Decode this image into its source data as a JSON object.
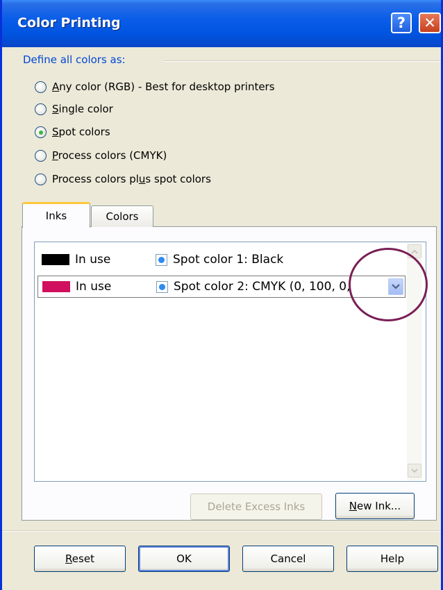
{
  "window": {
    "title": "Color Printing"
  },
  "define": {
    "label": "Define all colors as:",
    "options": [
      {
        "accel": "A",
        "rest": "ny color (RGB) - Best for desktop printers",
        "checked": false
      },
      {
        "accel": "S",
        "rest": "ingle color",
        "pre": "",
        "checked": false
      },
      {
        "accel": "S",
        "rest": "pot colors",
        "checked": true
      },
      {
        "accel": "P",
        "rest": "rocess colors (CMYK)",
        "checked": false
      },
      {
        "pre": "Process colors pl",
        "accel": "u",
        "rest": "s spot colors",
        "checked": false
      }
    ]
  },
  "tabs": {
    "inks": "Inks",
    "colors": "Colors"
  },
  "inks": [
    {
      "swatch": "#000000",
      "status": "In use",
      "name": "Spot color 1: Black"
    },
    {
      "swatch": "#d0105f",
      "status": "In use",
      "name": "Spot color 2: CMYK (0, 100, 0,"
    }
  ],
  "panel_buttons": {
    "delete_excess": "Delete Excess Inks",
    "new_ink_accel": "N",
    "new_ink_rest": "ew Ink..."
  },
  "footer_buttons": {
    "reset_accel": "R",
    "reset_rest": "eset",
    "ok": "OK",
    "cancel": "Cancel",
    "help": "Help"
  },
  "colors": {
    "titlebar": "#0a5de8",
    "dialog_bg": "#ece9d8",
    "tab_active_accent": "#ffc83c",
    "highlight_circle": "#7a1f55"
  }
}
